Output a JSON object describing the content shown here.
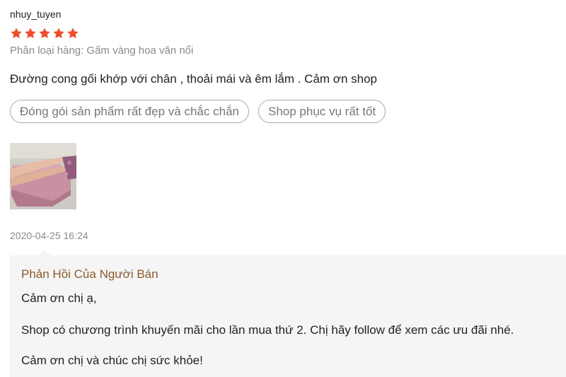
{
  "review": {
    "username": "nhuy_tuyen",
    "rating": 5,
    "rating_max": 5,
    "star_color": "#ee4d2d",
    "variation": "Phân loại hàng: Gấm vàng hoa văn nổi",
    "text": "Đường cong gối khớp với chân , thoải mái và êm lắm . Cảm ơn shop",
    "tags": [
      "Đóng gói sản phẩm rất đẹp và chắc chắn",
      "Shop phục vụ rất tốt"
    ],
    "photo_icon": "review-photo-thumbnail",
    "timestamp": "2020-04-25 16:24"
  },
  "seller_reply": {
    "title": "Phản Hồi Của Người Bán",
    "title_color": "#8b5a2b",
    "lines": [
      "Cảm ơn chị ạ,",
      "Shop có chương trình khuyến mãi cho lần mua thứ 2. Chị hãy follow để xem các ưu đãi nhé.",
      "Cảm ơn chị và chúc chị sức khỏe!"
    ]
  }
}
